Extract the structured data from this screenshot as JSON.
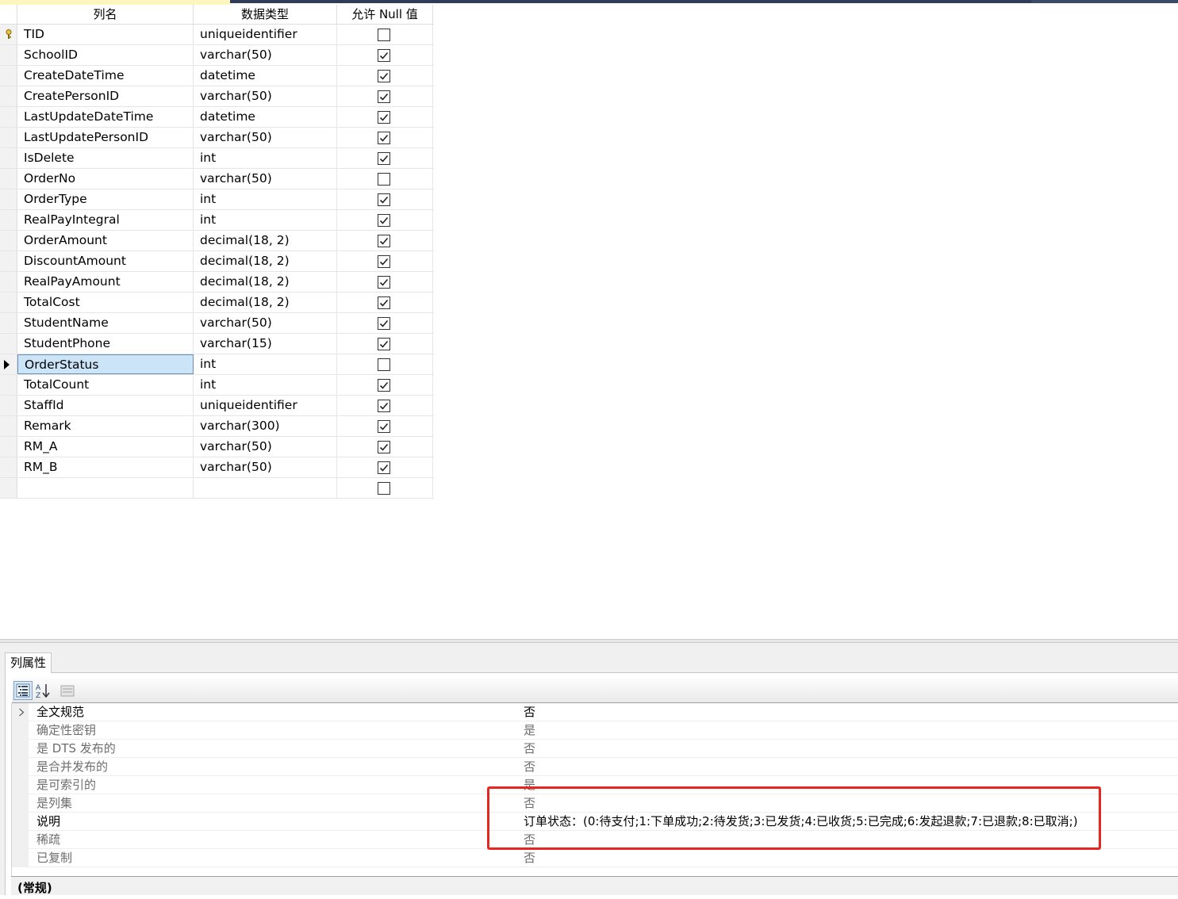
{
  "grid": {
    "headers": {
      "column_name": "列名",
      "data_type": "数据类型",
      "allow_null": "允许 Null 值"
    },
    "rows": [
      {
        "name": "TID",
        "type": "uniqueidentifier",
        "allow_null": false,
        "primary_key": true
      },
      {
        "name": "SchoolID",
        "type": "varchar(50)",
        "allow_null": true
      },
      {
        "name": "CreateDateTime",
        "type": "datetime",
        "allow_null": true
      },
      {
        "name": "CreatePersonID",
        "type": "varchar(50)",
        "allow_null": true
      },
      {
        "name": "LastUpdateDateTime",
        "type": "datetime",
        "allow_null": true
      },
      {
        "name": "LastUpdatePersonID",
        "type": "varchar(50)",
        "allow_null": true
      },
      {
        "name": "IsDelete",
        "type": "int",
        "allow_null": true
      },
      {
        "name": "OrderNo",
        "type": "varchar(50)",
        "allow_null": false
      },
      {
        "name": "OrderType",
        "type": "int",
        "allow_null": true
      },
      {
        "name": "RealPayIntegral",
        "type": "int",
        "allow_null": true
      },
      {
        "name": "OrderAmount",
        "type": "decimal(18, 2)",
        "allow_null": true
      },
      {
        "name": "DiscountAmount",
        "type": "decimal(18, 2)",
        "allow_null": true
      },
      {
        "name": "RealPayAmount",
        "type": "decimal(18, 2)",
        "allow_null": true
      },
      {
        "name": "TotalCost",
        "type": "decimal(18, 2)",
        "allow_null": true
      },
      {
        "name": "StudentName",
        "type": "varchar(50)",
        "allow_null": true
      },
      {
        "name": "StudentPhone",
        "type": "varchar(15)",
        "allow_null": true
      },
      {
        "name": "OrderStatus",
        "type": "int",
        "allow_null": false,
        "selected": true
      },
      {
        "name": "TotalCount",
        "type": "int",
        "allow_null": true
      },
      {
        "name": "StaffId",
        "type": "uniqueidentifier",
        "allow_null": true
      },
      {
        "name": "Remark",
        "type": "varchar(300)",
        "allow_null": true
      },
      {
        "name": "RM_A",
        "type": "varchar(50)",
        "allow_null": true
      },
      {
        "name": "RM_B",
        "type": "varchar(50)",
        "allow_null": true
      },
      {
        "name": "",
        "type": "",
        "allow_null": false
      }
    ]
  },
  "properties": {
    "tab_label": "列属性",
    "rows": [
      {
        "name": "全文规范",
        "value": "否",
        "expandable": true,
        "active": true
      },
      {
        "name": "确定性密钥",
        "value": "是"
      },
      {
        "name": "是 DTS 发布的",
        "value": "否"
      },
      {
        "name": "是合并发布的",
        "value": "否"
      },
      {
        "name": "是可索引的",
        "value": "是"
      },
      {
        "name": "是列集",
        "value": "否"
      },
      {
        "name": "说明",
        "value": "订单状态：(0:待支付;1:下单成功;2:待发货;3:已发货;4:已收货;5:已完成;6:发起退款;7:已退款;8:已取消;)",
        "active": true
      },
      {
        "name": "稀疏",
        "value": "否"
      },
      {
        "name": "已复制",
        "value": "否"
      }
    ],
    "category_label": "(常规)"
  },
  "icons": {
    "primary_key": "key-icon",
    "row_selector": "arrow-right-icon",
    "categorized": "categorized-icon",
    "alphabetical": "sort-az-icon",
    "property_pages": "property-pages-icon"
  },
  "colors": {
    "selected_cell": "#cce4f7",
    "highlight_box": "#e8261f",
    "tab_active": "#fdf6bd"
  }
}
